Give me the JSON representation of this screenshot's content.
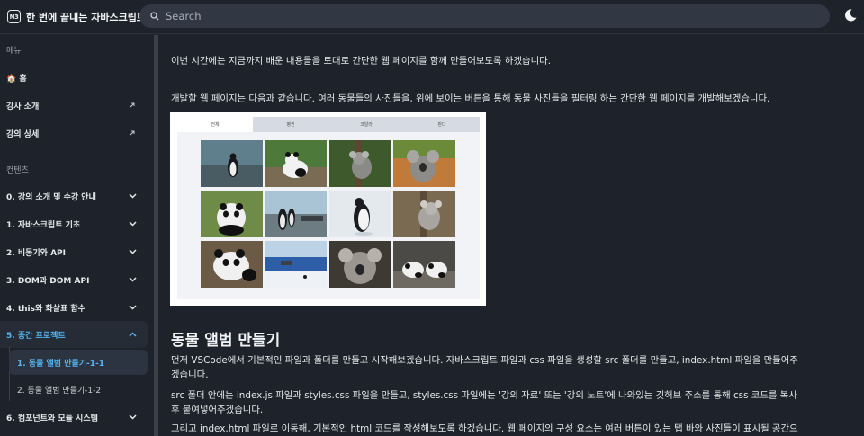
{
  "header": {
    "logo_text": "N3",
    "site_title": "한 번에 끝내는 자바스크립트",
    "search_placeholder": "Search",
    "theme_icon": "moon-icon"
  },
  "sidebar": {
    "menu_label": "메뉴",
    "home": "🏠 홈",
    "instructor": "강사 소개",
    "course_detail": "강의 상세",
    "contents_label": "컨텐츠",
    "chapters": [
      "0. 강의 소개 및 수강 안내",
      "1. 자바스크립트 기초",
      "2. 비동기와 API",
      "3. DOM과 DOM API",
      "4. this와 화살표 함수",
      "5. 중간 프로젝트",
      "6. 컴포넌트와 모듈 시스템"
    ],
    "subitems": [
      "1. 동물 앨범 만들기-1-1",
      "2. 동물 앨범 만들기-1-2"
    ]
  },
  "main": {
    "intro": "이번 시간에는 지금까지 배운 내용들을 토대로 간단한 웹 페이지를 함께 만들어보도록 하겠습니다.",
    "intro2": "개발할 웹 페이지는 다음과 같습니다. 여러 동물들의 사진들을, 위에 보이는 버튼을 통해 동물 사진들을 필터링 하는 간단한 웹 페이지를 개발해보겠습니다.",
    "preview_tabs": [
      "전체",
      "펭귄",
      "코알라",
      "판다"
    ],
    "heading": "동물 앨범 만들기",
    "para1_line1": "먼저 VSCode에서 기본적인 파일과 폴더를 만들고 시작해보겠습니다. 자바스크립트 파일과 css 파일을 생성할 src 폴더를 만들고, index.html 파일을 만들어주",
    "para1_line2": "겠습니다.",
    "para2_line1": "src 폴더 안에는 index.js 파일과 styles.css 파일을 만들고, styles.css 파일에는 '강의 자료' 또는 '강의 노트'에 나와있는 깃허브 주소를 통해 css 코드를 복사",
    "para2_line2": "후 붙여넣어주겠습니다.",
    "para3_line1": "그리고 index.html 파일로 이동해, 기본적인 html 코드를 작성해보도록 하겠습니다. 웹 페이지의 구성 요소는 여러 버튼이 있는 탭 바와 사진들이 표시될 공간으"
  }
}
